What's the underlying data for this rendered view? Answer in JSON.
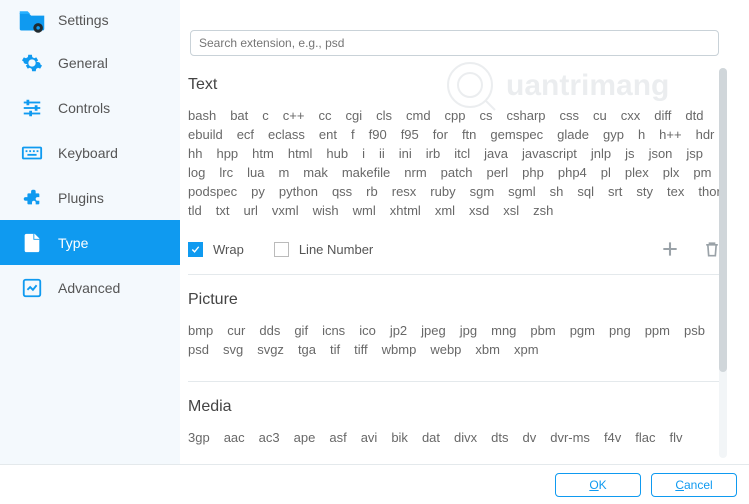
{
  "header": {
    "title": "Settings"
  },
  "sidebar": {
    "items": [
      {
        "label": "General"
      },
      {
        "label": "Controls"
      },
      {
        "label": "Keyboard"
      },
      {
        "label": "Plugins"
      },
      {
        "label": "Type"
      },
      {
        "label": "Advanced"
      }
    ]
  },
  "search": {
    "placeholder": "Search extension, e.g., psd"
  },
  "sections": {
    "text": {
      "title": "Text",
      "items": [
        "bash",
        "bat",
        "c",
        "c++",
        "cc",
        "cgi",
        "cls",
        "cmd",
        "cpp",
        "cs",
        "csharp",
        "css",
        "cu",
        "cxx",
        "diff",
        "dtd",
        "ebuild",
        "ecf",
        "eclass",
        "ent",
        "f",
        "f90",
        "f95",
        "for",
        "ftn",
        "gemspec",
        "glade",
        "gyp",
        "h",
        "h++",
        "hdr",
        "hh",
        "hpp",
        "htm",
        "html",
        "hub",
        "i",
        "ii",
        "ini",
        "irb",
        "itcl",
        "java",
        "javascript",
        "jnlp",
        "js",
        "json",
        "jsp",
        "log",
        "lrc",
        "lua",
        "m",
        "mak",
        "makefile",
        "nrm",
        "patch",
        "perl",
        "php",
        "php4",
        "pl",
        "plex",
        "plx",
        "pm",
        "podspec",
        "py",
        "python",
        "qss",
        "rb",
        "resx",
        "ruby",
        "sgm",
        "sgml",
        "sh",
        "sql",
        "srt",
        "sty",
        "tex",
        "thor",
        "tld",
        "txt",
        "url",
        "vxml",
        "wish",
        "wml",
        "xhtml",
        "xml",
        "xsd",
        "xsl",
        "zsh"
      ]
    },
    "picture": {
      "title": "Picture",
      "items": [
        "bmp",
        "cur",
        "dds",
        "gif",
        "icns",
        "ico",
        "jp2",
        "jpeg",
        "jpg",
        "mng",
        "pbm",
        "pgm",
        "png",
        "ppm",
        "psb",
        "psd",
        "svg",
        "svgz",
        "tga",
        "tif",
        "tiff",
        "wbmp",
        "webp",
        "xbm",
        "xpm"
      ]
    },
    "media": {
      "title": "Media",
      "items": [
        "3gp",
        "aac",
        "ac3",
        "ape",
        "asf",
        "avi",
        "bik",
        "dat",
        "divx",
        "dts",
        "dv",
        "dvr-ms",
        "f4v",
        "flac",
        "flv"
      ]
    }
  },
  "options": {
    "wrap": {
      "label": "Wrap",
      "checked": true
    },
    "lineNumber": {
      "label": "Line Number",
      "checked": false
    }
  },
  "footer": {
    "ok": "OK",
    "cancel": "Cancel"
  },
  "watermark": "Quantrimang"
}
